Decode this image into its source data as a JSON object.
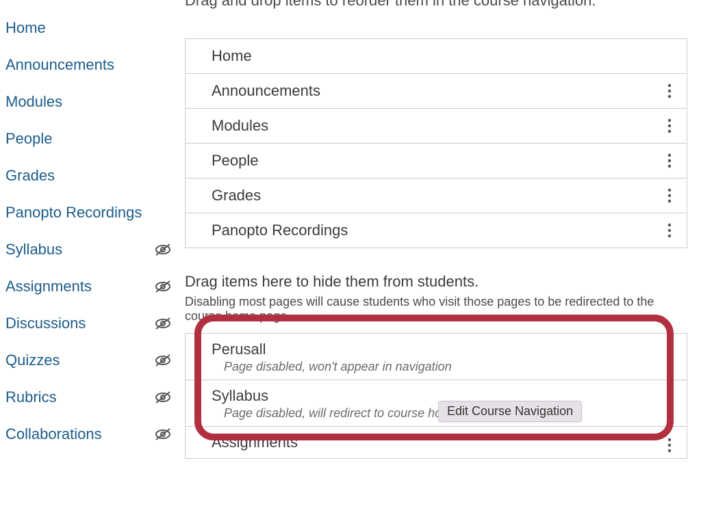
{
  "sidebar": {
    "items": [
      {
        "label": "Home",
        "hidden": false
      },
      {
        "label": "Announcements",
        "hidden": false
      },
      {
        "label": "Modules",
        "hidden": false
      },
      {
        "label": "People",
        "hidden": false
      },
      {
        "label": "Grades",
        "hidden": false
      },
      {
        "label": "Panopto Recordings",
        "hidden": false
      },
      {
        "label": "Syllabus",
        "hidden": true
      },
      {
        "label": "Assignments",
        "hidden": true
      },
      {
        "label": "Discussions",
        "hidden": true
      },
      {
        "label": "Quizzes",
        "hidden": true
      },
      {
        "label": "Rubrics",
        "hidden": true
      },
      {
        "label": "Collaborations",
        "hidden": true
      }
    ]
  },
  "main": {
    "top_instruction": "Drag and drop items to reorder them in the course navigation.",
    "enabled": [
      {
        "label": "Home",
        "has_menu": false
      },
      {
        "label": "Announcements",
        "has_menu": true
      },
      {
        "label": "Modules",
        "has_menu": true
      },
      {
        "label": "People",
        "has_menu": true
      },
      {
        "label": "Grades",
        "has_menu": true
      },
      {
        "label": "Panopto Recordings",
        "has_menu": true
      }
    ],
    "hidden_header": "Drag items here to hide them from students.",
    "hidden_sub": "Disabling most pages will cause students who visit those pages to be redirected to the course home page.",
    "hidden": [
      {
        "label": "Perusall",
        "sub": "Page disabled, won't appear in navigation"
      },
      {
        "label": "Syllabus",
        "sub": "Page disabled, will redirect to course home page"
      },
      {
        "label": "Assignments",
        "sub": ""
      }
    ],
    "tooltip": "Edit Course Navigation"
  }
}
